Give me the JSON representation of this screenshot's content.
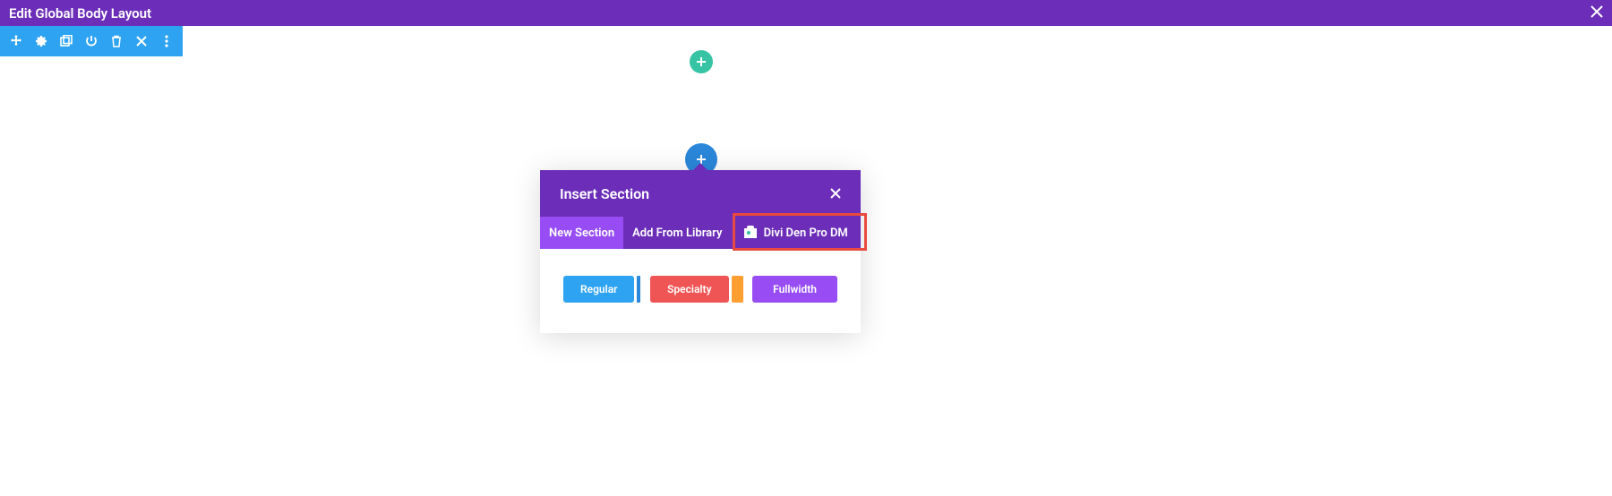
{
  "topBar": {
    "title": "Edit Global Body Layout"
  },
  "modal": {
    "title": "Insert Section",
    "tabs": {
      "newSection": "New Section",
      "addFromLibrary": "Add From Library",
      "diviDenPro": "Divi Den Pro DM"
    },
    "buttons": {
      "regular": "Regular",
      "specialty": "Specialty",
      "fullwidth": "Fullwidth"
    }
  }
}
